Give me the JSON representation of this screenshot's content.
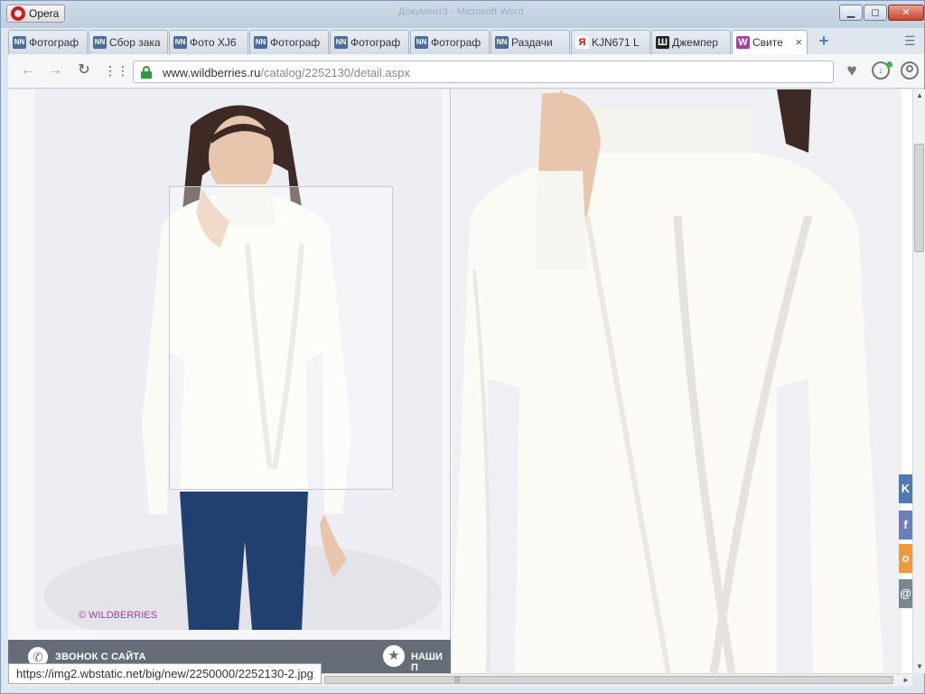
{
  "window": {
    "menu_button": "Opera",
    "caption": "Документ3 - Microsoft Word",
    "minimize": "▁",
    "maximize": "◻",
    "close": "✕"
  },
  "tabs": [
    {
      "icon": "NN",
      "label": "Фотограф",
      "active": false
    },
    {
      "icon": "NN",
      "label": "Сбор зака",
      "active": false
    },
    {
      "icon": "NN",
      "label": "Фото XJ6",
      "active": false
    },
    {
      "icon": "NN",
      "label": "Фотограф",
      "active": false
    },
    {
      "icon": "NN",
      "label": "Фотограф",
      "active": false
    },
    {
      "icon": "NN",
      "label": "Фотограф",
      "active": false
    },
    {
      "icon": "NN",
      "label": "Раздачи",
      "active": false
    },
    {
      "icon": "Я",
      "label": "KJN671 L",
      "active": false
    },
    {
      "icon": "Ш",
      "label": "Джемпер",
      "active": false
    },
    {
      "icon": "W",
      "label": "Свите",
      "active": true
    }
  ],
  "tab_close": "×",
  "new_tab": "+",
  "tab_menu": "☰",
  "address": {
    "host": "www.wildberries.ru",
    "path": "/catalog/2252130/detail.aspx"
  },
  "toolbar": {
    "back": "←",
    "forward": "→",
    "reload": "↻",
    "speed_dial": "⋮⋮⋮",
    "heart": "♥",
    "download": "↓"
  },
  "page": {
    "watermark": "© WILDBERRIES",
    "callback_label": "ЗВОНОК С САЙТА",
    "ours_label": "НАШИ П",
    "phone_glyph": "✆",
    "star_glyph": "★",
    "social": {
      "vk": "K",
      "fb": "f",
      "ok": "o",
      "mail": "@"
    }
  },
  "status_url": "https://img2.wbstatic.net/big/new/2250000/2252130-2.jpg",
  "scroll": {
    "up": "▲",
    "down": "▼",
    "right": "►",
    "grip": "|||"
  },
  "colors": {
    "brand_purple": "#a83f9c",
    "lock_green": "#2f9c3a",
    "bar_gray": "#656d78"
  }
}
